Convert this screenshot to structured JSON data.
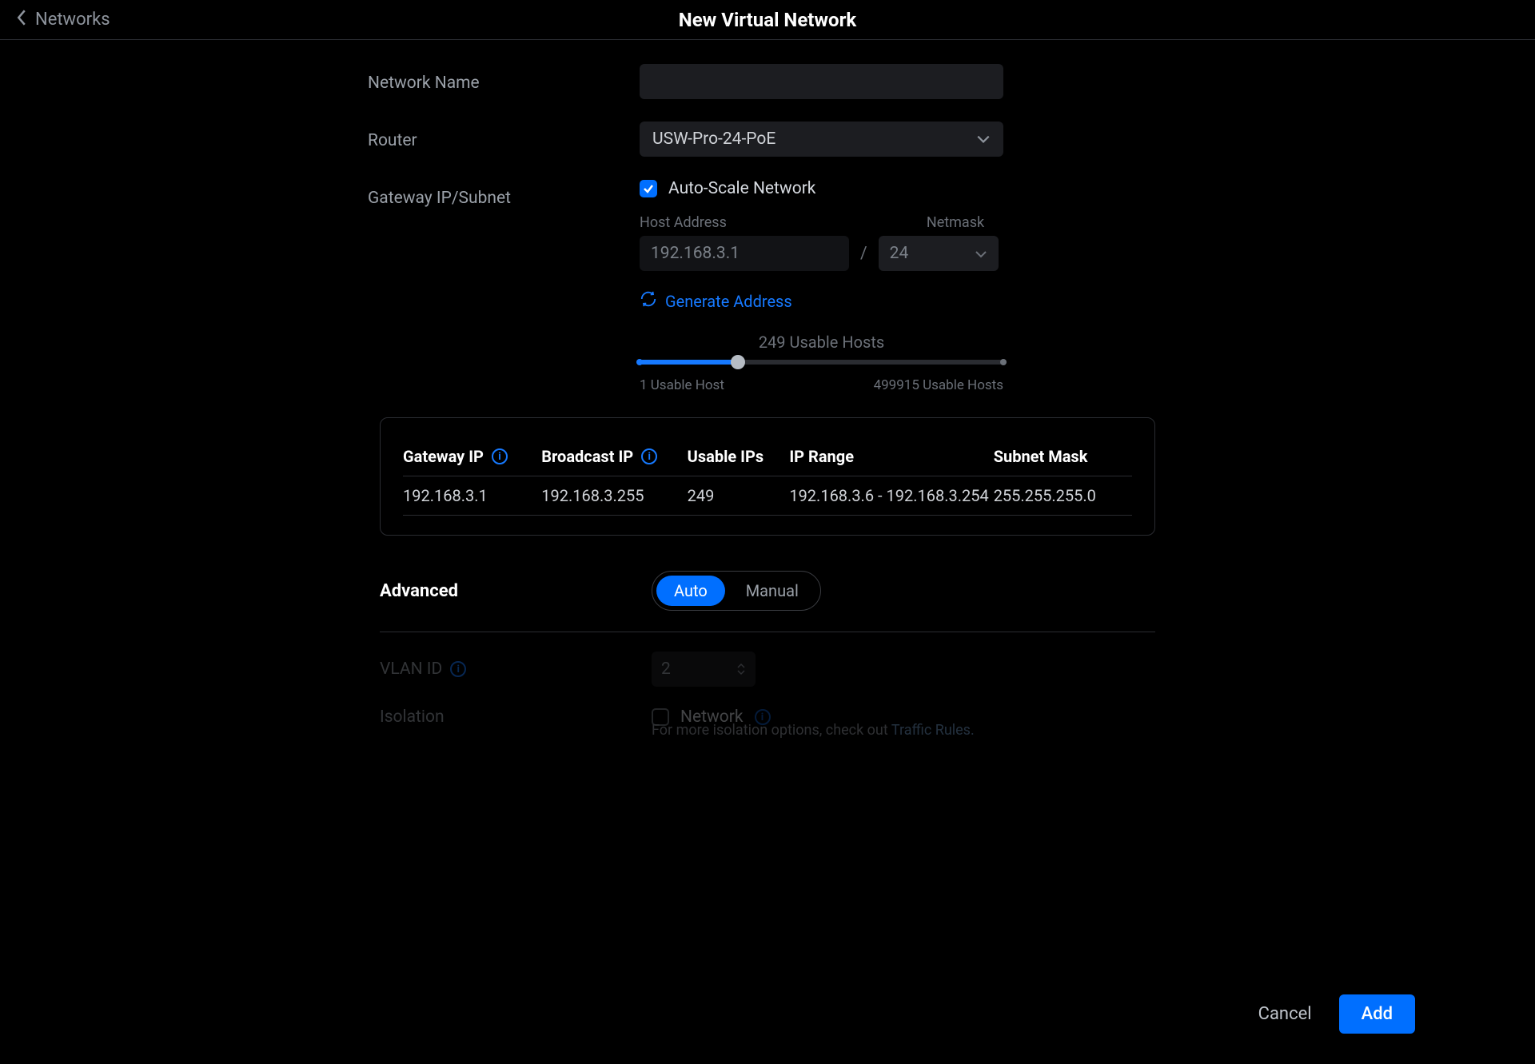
{
  "header": {
    "back_label": "Networks",
    "title": "New Virtual Network"
  },
  "form": {
    "network_name_label": "Network Name",
    "network_name_value": "",
    "router_label": "Router",
    "router_value": "USW-Pro-24-PoE",
    "gateway_label": "Gateway IP/Subnet",
    "auto_scale_label": "Auto-Scale Network",
    "auto_scale_checked": true,
    "host_address_label": "Host Address",
    "host_address_value": "192.168.3.1",
    "netmask_label": "Netmask",
    "netmask_value": "24",
    "generate_label": "Generate Address",
    "usable_hosts_current": "249 Usable Hosts",
    "usable_hosts_min": "1 Usable Host",
    "usable_hosts_max": "499915 Usable Hosts"
  },
  "subnet": {
    "headers": {
      "gateway_ip": "Gateway IP",
      "broadcast_ip": "Broadcast IP",
      "usable_ips": "Usable IPs",
      "ip_range": "IP Range",
      "subnet_mask": "Subnet Mask"
    },
    "row": {
      "gateway_ip": "192.168.3.1",
      "broadcast_ip": "192.168.3.255",
      "usable_ips": "249",
      "ip_range": "192.168.3.6 - 192.168.3.254",
      "subnet_mask": "255.255.255.0"
    }
  },
  "advanced": {
    "label": "Advanced",
    "auto": "Auto",
    "manual": "Manual",
    "vlan_label": "VLAN ID",
    "vlan puntAct": "",
    "vlan_value": "2",
    "isolation_label": "Isolation",
    "isolation_network_label": "Network",
    "isolation_note_prefix": "For more isolation options, check out ",
    "isolation_note_link": "Traffic Rules."
  },
  "footer": {
    "cancel": "Cancel",
    "add": "Add"
  }
}
